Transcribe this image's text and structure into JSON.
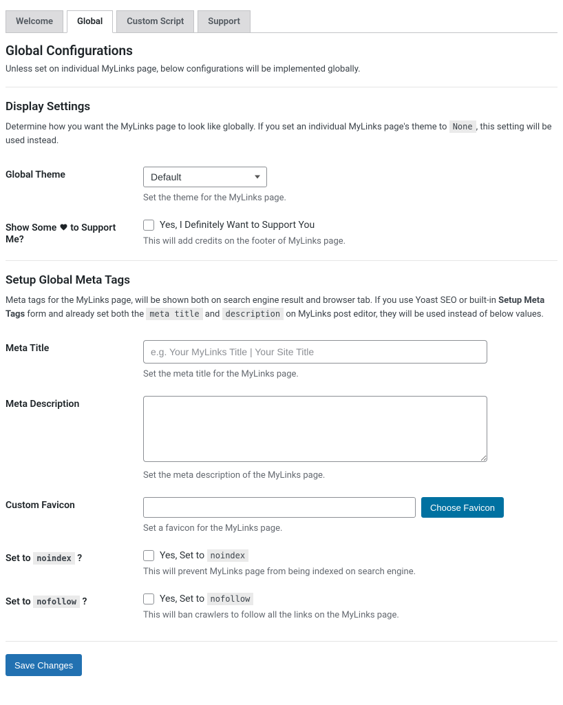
{
  "tabs": {
    "welcome": "Welcome",
    "global": "Global",
    "custom_script": "Custom Script",
    "support": "Support"
  },
  "page": {
    "title": "Global Configurations",
    "desc": "Unless set on individual MyLinks page, below configurations will be implemented globally."
  },
  "display_section": {
    "title": "Display Settings",
    "desc_part1": "Determine how you want the MyLinks page to look like globally. If you set an individual MyLinks page's theme to ",
    "desc_code": "None",
    "desc_part2": ", this setting will be used instead.",
    "global_theme": {
      "label": "Global Theme",
      "selected": "Default",
      "help": "Set the theme for the MyLinks page."
    },
    "support_me": {
      "label_pre": "Show Some ",
      "label_post": " to Support Me?",
      "checkbox_label": "Yes, I Definitely Want to Support You",
      "help": "This will add credits on the footer of MyLinks page."
    }
  },
  "meta_section": {
    "title": "Setup Global Meta Tags",
    "desc_part1": "Meta tags for the MyLinks page, will be shown both on search engine result and browser tab. If you use Yoast SEO or built-in ",
    "desc_bold": "Setup Meta Tags",
    "desc_part2": " form and already set both the ",
    "desc_code1": "meta title",
    "desc_mid": " and ",
    "desc_code2": "description",
    "desc_part3": " on MyLinks post editor, they will be used instead of below values.",
    "meta_title": {
      "label": "Meta Title",
      "placeholder": "e.g. Your MyLinks Title | Your Site Title",
      "help": "Set the meta title for the MyLinks page."
    },
    "meta_description": {
      "label": "Meta Description",
      "help": "Set the meta description of the MyLinks page."
    },
    "favicon": {
      "label": "Custom Favicon",
      "button": "Choose Favicon",
      "help": "Set a favicon for the MyLinks page."
    },
    "noindex": {
      "label_pre": "Set to ",
      "label_code": "noindex",
      "label_post": " ?",
      "checkbox_pre": "Yes, Set to ",
      "checkbox_code": "noindex",
      "help": "This will prevent MyLinks page from being indexed on search engine."
    },
    "nofollow": {
      "label_pre": "Set to ",
      "label_code": "nofollow",
      "label_post": " ?",
      "checkbox_pre": "Yes, Set to ",
      "checkbox_code": "nofollow",
      "help": "This will ban crawlers to follow all the links on the MyLinks page."
    }
  },
  "save_button": "Save Changes"
}
